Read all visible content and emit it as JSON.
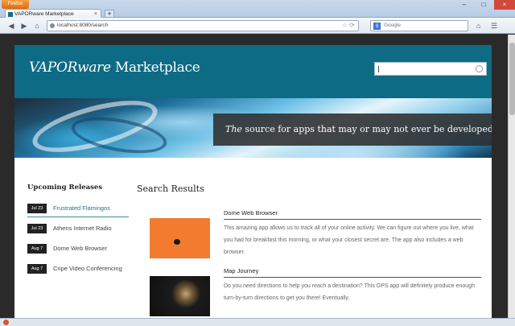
{
  "browser": {
    "menu_button": "Firefox",
    "tab_title": "VAPORware Marketplace",
    "new_tab": "+",
    "close_tab": "×",
    "window_min": "–",
    "window_max": "□",
    "window_close": "×",
    "back": "◀",
    "forward": "▶",
    "home": "⌂",
    "url": "localhost:8080/search",
    "url_tools": "☆ ⟳",
    "search_engine_icon": "g",
    "search_placeholder": "Google",
    "home_right": "⌂",
    "menu_right": "☰"
  },
  "site": {
    "logo_italic": "VAPORware",
    "logo_rest": " Marketplace",
    "search_placeholder": "",
    "tagline_italic": "The",
    "tagline_rest": " source for apps that may or may not ever be developed"
  },
  "sidebar": {
    "title": "Upcoming Releases",
    "releases": [
      {
        "date": "Jul 23",
        "name": "Frustrated Flamingos",
        "active": true
      },
      {
        "date": "Jul 23",
        "name": "Athens Internet Radio",
        "active": false
      },
      {
        "date": "Aug 7",
        "name": "Dome Web Browser",
        "active": false
      },
      {
        "date": "Aug 7",
        "name": "Cripe Video Conferencing",
        "active": false
      }
    ]
  },
  "results": {
    "title": "Search Results",
    "items": [
      {
        "name": "Dome Web Browser",
        "description": "This amazing app allows us to track all of your online activity. We can figure out where you live, what you had for breakfast this morning, or what your closest secret are. The app also includes a web browser."
      },
      {
        "name": "Map Journey",
        "description": "Do you need directions to help you reach a destination? This GPS app will definitely produce enough turn-by-turn directions to get you there! Eventually."
      }
    ]
  },
  "colors": {
    "header": "#0e6b85",
    "accent": "#26718a",
    "tagline_bg": "#2d2d2d"
  }
}
